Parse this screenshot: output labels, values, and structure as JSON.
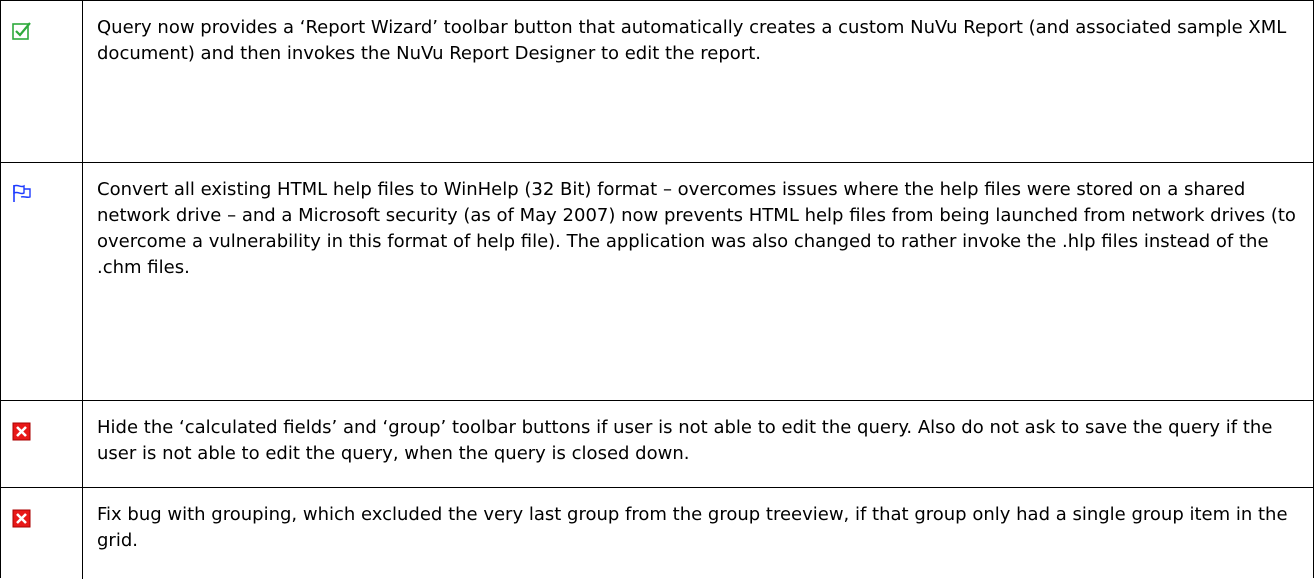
{
  "rows": [
    {
      "status": "done",
      "icon": "checked-box-icon",
      "text": "Query now provides a ‘Report Wizard’ toolbar button that automatically creates a custom NuVu Report (and associated sample XML document) and then invokes the NuVu Report Designer to edit the report."
    },
    {
      "status": "in-progress",
      "icon": "flag-icon",
      "text": "Convert all existing HTML help files to WinHelp (32 Bit) format – overcomes issues where the help files were stored on a shared network drive – and a Microsoft security (as of May 2007) now prevents HTML help files from being launched from network drives (to overcome a vulnerability in this format of help file).  The application was also changed to rather invoke the .hlp files instead of the .chm files."
    },
    {
      "status": "cancelled",
      "icon": "x-box-icon",
      "text": "Hide the ‘calculated fields’ and ‘group’ toolbar buttons if user is not able to edit the query.  Also do not ask to save the query if the user is not able to edit the query, when the query is closed down."
    },
    {
      "status": "cancelled",
      "icon": "x-box-icon",
      "text": "Fix bug with grouping, which excluded the very last group from the group treeview, if that group only had a single group item in the grid."
    }
  ],
  "colors": {
    "check": "#2eaa3c",
    "flag": "#1f3cff",
    "x_fill": "#e81818",
    "border": "#000000"
  }
}
